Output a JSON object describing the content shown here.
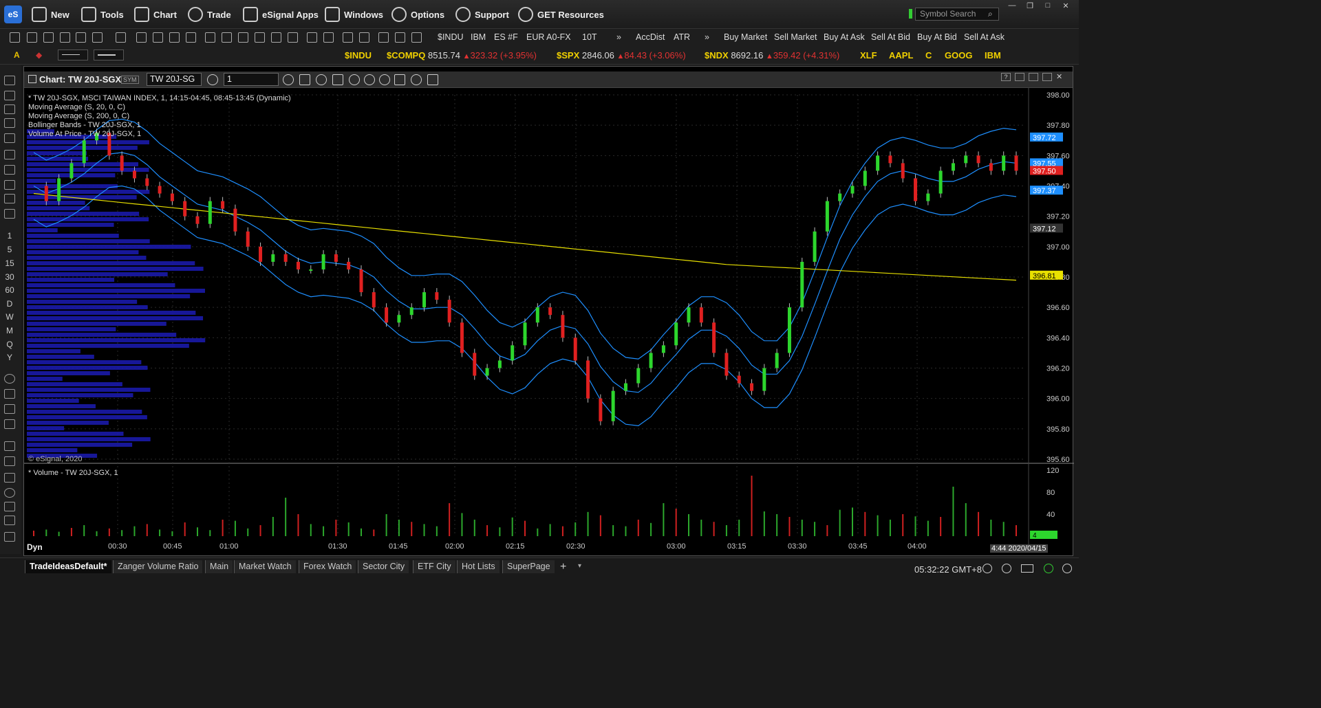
{
  "menu": {
    "logo": "eS",
    "items": [
      {
        "label": "New",
        "icon": "new-window-icon"
      },
      {
        "label": "Tools",
        "icon": "tools-icon"
      },
      {
        "label": "Chart",
        "icon": "chart-icon"
      },
      {
        "label": "Trade",
        "icon": "globe-icon"
      },
      {
        "label": "eSignal Apps",
        "icon": "apps-icon"
      },
      {
        "label": "Windows",
        "icon": "windows-icon"
      },
      {
        "label": "Options",
        "icon": "gear-icon"
      },
      {
        "label": "Support",
        "icon": "help-icon"
      },
      {
        "label": "GET Resources",
        "icon": "get-icon"
      }
    ],
    "search_placeholder": "Symbol Search"
  },
  "toolbar2": {
    "links": [
      "$INDU",
      "IBM",
      "ES #F",
      "EUR A0-FX",
      "10T"
    ],
    "studies": [
      "AccDist",
      "ATR"
    ],
    "trade_buttons": [
      "Buy Market",
      "Sell Market",
      "Buy At Ask",
      "Sell At Bid",
      "Buy At Bid",
      "Sell At Ask"
    ]
  },
  "ticker": [
    {
      "symbol": "$INDU",
      "last": "",
      "change": ""
    },
    {
      "symbol": "$COMPQ",
      "last": "8515.74",
      "change": "323.32 (+3.95%)"
    },
    {
      "symbol": "$SPX",
      "last": "2846.06",
      "change": "84.43 (+3.06%)"
    },
    {
      "symbol": "$NDX",
      "last": "8692.16",
      "change": "359.42 (+4.31%)"
    },
    {
      "symbol": "XLF",
      "last": "",
      "change": ""
    },
    {
      "symbol": "AAPL",
      "last": "",
      "change": ""
    },
    {
      "symbol": "C",
      "last": "",
      "change": ""
    },
    {
      "symbol": "GOOG",
      "last": "",
      "change": ""
    },
    {
      "symbol": "IBM",
      "last": "",
      "change": ""
    }
  ],
  "left_intervals": [
    "1",
    "5",
    "15",
    "30",
    "60",
    "D",
    "W",
    "M",
    "Q",
    "Y"
  ],
  "chart": {
    "title": "Chart: TW 20J-SGX",
    "symbol": "TW 20J-SG",
    "interval": "1",
    "legend": [
      "* TW 20J-SGX, MSCI TAIWAN INDEX, 1, 14:15-04:45, 08:45-13:45 (Dynamic)",
      "Moving Average (S, 20, 0, C)",
      "Moving Average (S, 200, 0, C)",
      "Bollinger Bands - TW 20J-SGX, 1",
      "Volume At Price - TW 20J-SGX, 1"
    ],
    "copyright": "© eSignal, 2020",
    "volume_title": "* Volume - TW 20J-SGX, 1",
    "footer_left": "Dyn",
    "footer_date": "4:44 2020/04/15"
  },
  "chart_data": {
    "type": "line",
    "price_axis": {
      "ticks": [
        "398.00",
        "397.80",
        "397.60",
        "397.40",
        "397.20",
        "397.00",
        "396.80",
        "396.60",
        "396.40",
        "396.20",
        "396.00",
        "395.80",
        "395.60"
      ],
      "ylim": [
        395.6,
        398.0
      ]
    },
    "price_labels": [
      {
        "value": "397.72",
        "color": "#1e8fff"
      },
      {
        "value": "397.55",
        "color": "#1e8fff"
      },
      {
        "value": "397.50",
        "color": "#e02020"
      },
      {
        "value": "397.37",
        "color": "#1e8fff"
      },
      {
        "value": "397.12",
        "color": "#333333"
      },
      {
        "value": "396.81",
        "color": "#e8e000"
      }
    ],
    "x_ticks": [
      "00:30",
      "00:45",
      "01:00",
      "01:30",
      "01:45",
      "02:00",
      "02:15",
      "02:30",
      "03:00",
      "03:15",
      "03:30",
      "03:45",
      "04:00"
    ],
    "volume_axis": {
      "ticks": [
        "120",
        "80",
        "40"
      ],
      "current": "4"
    },
    "series": [
      {
        "name": "Moving Average (S, 20, 0, C)",
        "color": "#1e8fff"
      },
      {
        "name": "Moving Average (S, 200, 0, C)",
        "color": "#e8e000"
      }
    ],
    "price_series": [
      397.4,
      397.3,
      397.45,
      397.55,
      397.7,
      397.75,
      397.6,
      397.5,
      397.45,
      397.4,
      397.35,
      397.3,
      397.2,
      397.15,
      397.3,
      397.25,
      397.1,
      397.0,
      396.9,
      396.95,
      396.9,
      396.85,
      396.85,
      396.95,
      396.9,
      396.85,
      396.7,
      396.6,
      396.5,
      396.55,
      396.6,
      396.7,
      396.65,
      396.5,
      396.3,
      396.15,
      396.2,
      396.25,
      396.35,
      396.5,
      396.6,
      396.55,
      396.4,
      396.25,
      396.0,
      395.85,
      396.05,
      396.1,
      396.2,
      396.3,
      396.35,
      396.5,
      396.6,
      396.5,
      396.3,
      396.15,
      396.1,
      396.05,
      396.2,
      396.3,
      396.6,
      396.9,
      397.1,
      397.3,
      397.35,
      397.4,
      397.5,
      397.6,
      397.55,
      397.45,
      397.3,
      397.35,
      397.5,
      397.55,
      397.6,
      397.55,
      397.5,
      397.6,
      397.5
    ],
    "volume_series": [
      10,
      12,
      8,
      15,
      20,
      9,
      14,
      11,
      18,
      22,
      12,
      9,
      25,
      16,
      11,
      30,
      28,
      14,
      20,
      35,
      70,
      40,
      22,
      18,
      30,
      25,
      14,
      12,
      40,
      30,
      26,
      22,
      18,
      60,
      42,
      30,
      20,
      16,
      34,
      28,
      14,
      22,
      18,
      25,
      44,
      38,
      20,
      18,
      30,
      24,
      60,
      50,
      40,
      30,
      26,
      20,
      30,
      110,
      45,
      40,
      35,
      30,
      26,
      20,
      48,
      52,
      44,
      38,
      30,
      40,
      36,
      28,
      35,
      90,
      60,
      44,
      30,
      26,
      20
    ]
  },
  "tabs": [
    "TradeIdeasDefault*",
    "Zanger Volume Ratio",
    "Main",
    "Market Watch",
    "Forex Watch",
    "Sector City",
    "ETF City",
    "Hot Lists",
    "SuperPage"
  ],
  "status": {
    "clock": "05:32:22 GMT+8"
  }
}
